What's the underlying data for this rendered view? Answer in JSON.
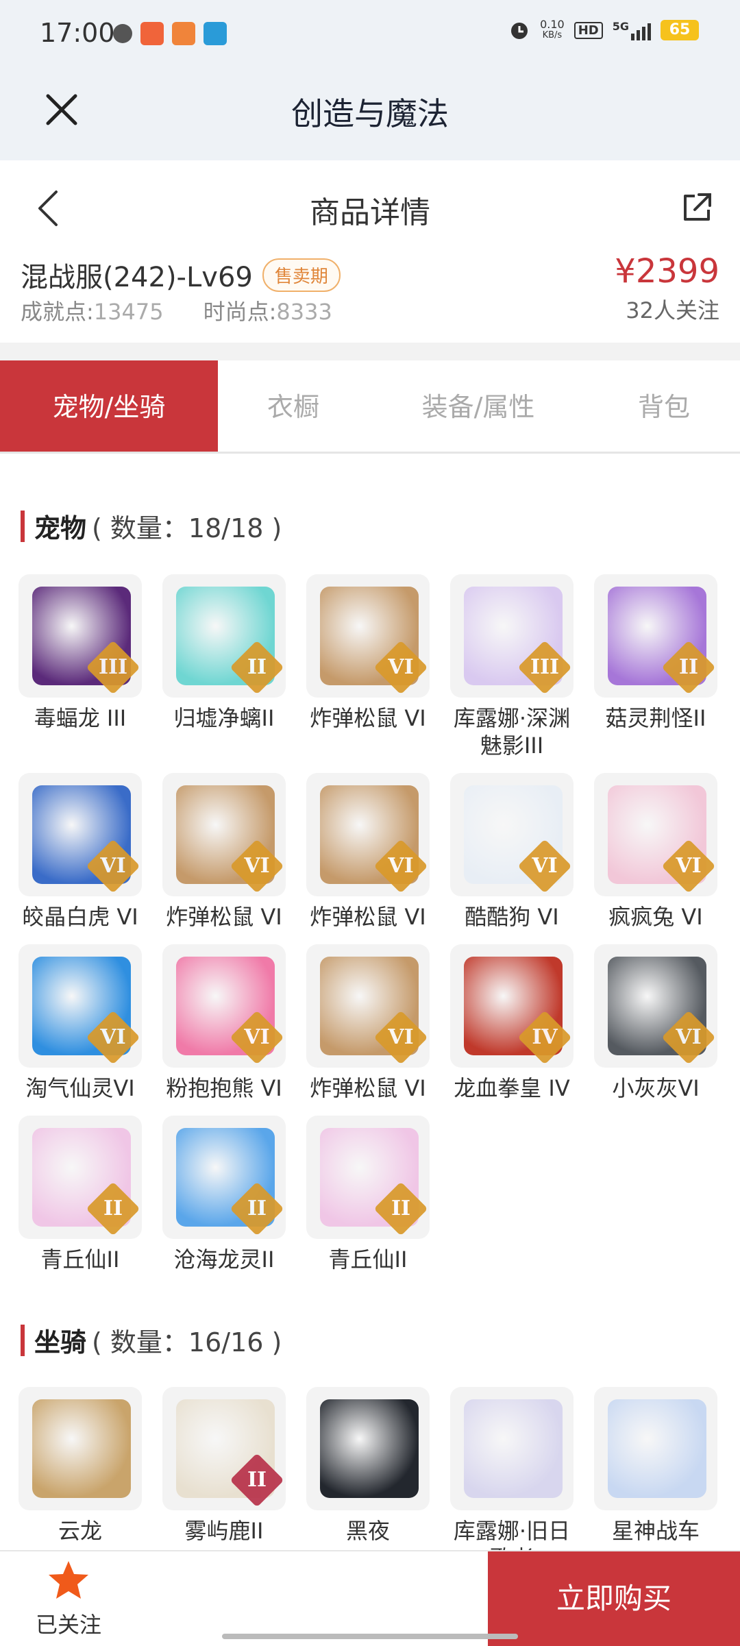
{
  "status_bar": {
    "time": "17:00",
    "network_speed_value": "0.10",
    "network_speed_unit": "KB/s",
    "hd": "HD",
    "network": "5G",
    "battery": "65"
  },
  "top_bar": {
    "title": "创造与魔法",
    "close_icon": "close-icon"
  },
  "nav_bar": {
    "title": "商品详情",
    "back_icon": "chevron-left-icon",
    "share_icon": "share-icon"
  },
  "product": {
    "server_level": "混战服(242)-Lv69",
    "status_badge": "售卖期",
    "achievement_label": "成就点:",
    "achievement_value": "13475",
    "fashion_label": "时尚点:",
    "fashion_value": "8333",
    "price": "¥2399",
    "followers": "32人关注"
  },
  "tabs": [
    {
      "label": "宠物/坐骑",
      "active": true
    },
    {
      "label": "衣橱",
      "active": false
    },
    {
      "label": "装备/属性",
      "active": false
    },
    {
      "label": "背包",
      "active": false
    }
  ],
  "pets_section": {
    "name": "宠物",
    "count": "( 数量：18/18 )"
  },
  "pets": [
    {
      "name": "毒蝠龙 III",
      "tier": "III",
      "color": "#5b2a7a",
      "tier_color": "#d99a2b"
    },
    {
      "name": "归墟净螭II",
      "tier": "II",
      "color": "#6fd6d2",
      "tier_color": "#d99a2b"
    },
    {
      "name": "炸弹松鼠 VI",
      "tier": "VI",
      "color": "#c59a6a",
      "tier_color": "#d99a2b"
    },
    {
      "name": "库露娜·深渊魅影III",
      "tier": "III",
      "color": "#d9c9f0",
      "tier_color": "#d99a2b"
    },
    {
      "name": "菇灵荆怪II",
      "tier": "II",
      "color": "#a676d8",
      "tier_color": "#d99a2b"
    },
    {
      "name": "皎晶白虎 VI",
      "tier": "VI",
      "color": "#3a6cc8",
      "tier_color": "#d99a2b"
    },
    {
      "name": "炸弹松鼠 VI",
      "tier": "VI",
      "color": "#c59a6a",
      "tier_color": "#d99a2b"
    },
    {
      "name": "炸弹松鼠 VI",
      "tier": "VI",
      "color": "#c59a6a",
      "tier_color": "#d99a2b"
    },
    {
      "name": "酷酷狗 VI",
      "tier": "VI",
      "color": "#e8eef5",
      "tier_color": "#d99a2b"
    },
    {
      "name": "疯疯兔 VI",
      "tier": "VI",
      "color": "#f2c7d8",
      "tier_color": "#d99a2b"
    },
    {
      "name": "淘气仙灵VI",
      "tier": "VI",
      "color": "#2f8fe0",
      "tier_color": "#d99a2b"
    },
    {
      "name": "粉抱抱熊 VI",
      "tier": "VI",
      "color": "#f07aa8",
      "tier_color": "#d99a2b"
    },
    {
      "name": "炸弹松鼠 VI",
      "tier": "VI",
      "color": "#c59a6a",
      "tier_color": "#d99a2b"
    },
    {
      "name": "龙血拳皇 IV",
      "tier": "IV",
      "color": "#c0392b",
      "tier_color": "#d99a2b"
    },
    {
      "name": "小灰灰VI",
      "tier": "VI",
      "color": "#555a60",
      "tier_color": "#d99a2b"
    },
    {
      "name": "青丘仙II",
      "tier": "II",
      "color": "#f0c6e6",
      "tier_color": "#d99a2b"
    },
    {
      "name": "沧海龙灵II",
      "tier": "II",
      "color": "#5aa6ea",
      "tier_color": "#d99a2b"
    },
    {
      "name": "青丘仙II",
      "tier": "II",
      "color": "#f0c6e6",
      "tier_color": "#d99a2b"
    }
  ],
  "mounts_section": {
    "name": "坐骑",
    "count": "( 数量：16/16 )"
  },
  "mounts": [
    {
      "name": "云龙",
      "tier": "",
      "color": "#c9a46b",
      "tier_color": ""
    },
    {
      "name": "雾屿鹿II",
      "tier": "II",
      "color": "#e8e0d0",
      "tier_color": "#b8324a"
    },
    {
      "name": "黑夜",
      "tier": "",
      "color": "#23272e",
      "tier_color": ""
    },
    {
      "name": "库露娜·旧日歌者",
      "tier": "",
      "color": "#d8d6ee",
      "tier_color": ""
    },
    {
      "name": "星神战车",
      "tier": "",
      "color": "#c8d8f2",
      "tier_color": ""
    }
  ],
  "bottom_bar": {
    "follow_label": "已关注",
    "buy_label": "立即购买",
    "star_icon": "star-icon"
  },
  "colors": {
    "accent": "#c9363b",
    "badge": "#e0863a",
    "header_bg": "#eef2f6"
  }
}
